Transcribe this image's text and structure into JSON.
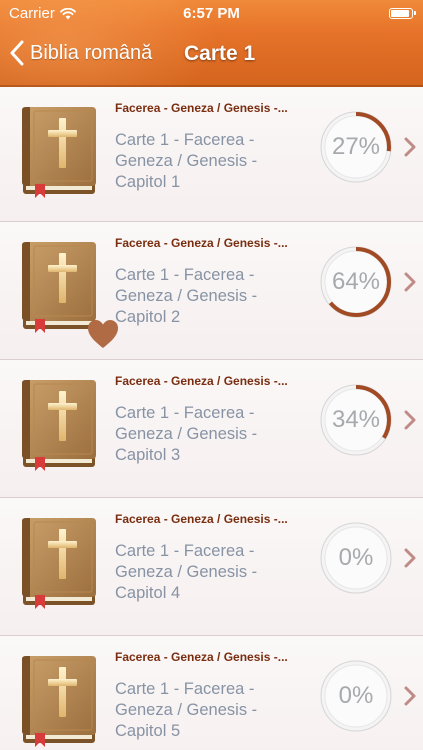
{
  "status_bar": {
    "carrier": "Carrier",
    "time": "6:57 PM",
    "icons": [
      "wifi-icon",
      "battery-icon"
    ]
  },
  "nav": {
    "back_label": "Biblia română",
    "title": "Carte 1",
    "back_icon": "chevron-left-icon"
  },
  "colors": {
    "header_orange": "#e3702a",
    "title_brown": "#7a2e10",
    "subtitle_gray": "#8793a4",
    "progress_arc": "#a14a24",
    "heart": "#b06a44"
  },
  "rows": [
    {
      "title": "Facerea - Geneza / Genesis  -...",
      "line1": "Carte 1 - Facerea -",
      "line2": "Geneza / Genesis  -",
      "line3": "Capitol 1",
      "percent_label": "27%",
      "progress": 0.27,
      "favorite": false
    },
    {
      "title": "Facerea - Geneza / Genesis  -...",
      "line1": "Carte 1 - Facerea -",
      "line2": "Geneza / Genesis  -",
      "line3": "Capitol 2",
      "percent_label": "64%",
      "progress": 0.64,
      "favorite": true
    },
    {
      "title": "Facerea - Geneza / Genesis  -...",
      "line1": "Carte 1 - Facerea -",
      "line2": "Geneza / Genesis  -",
      "line3": "Capitol 3",
      "percent_label": "34%",
      "progress": 0.34,
      "favorite": false
    },
    {
      "title": "Facerea - Geneza / Genesis  -...",
      "line1": "Carte 1 - Facerea -",
      "line2": "Geneza / Genesis  -",
      "line3": "Capitol 4",
      "percent_label": "0%",
      "progress": 0,
      "favorite": false
    },
    {
      "title": "Facerea - Geneza / Genesis  -...",
      "line1": "Carte 1 - Facerea -",
      "line2": "Geneza / Genesis  -",
      "line3": "Capitol 5",
      "percent_label": "0%",
      "progress": 0,
      "favorite": false
    }
  ]
}
